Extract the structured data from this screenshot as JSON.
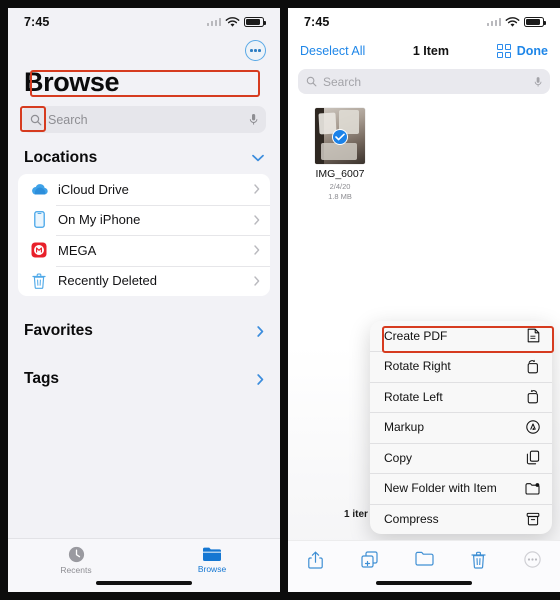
{
  "left": {
    "status": {
      "time": "7:45",
      "wifi_icon": "wifi-icon",
      "battery_icon": "battery-icon"
    },
    "more_button": "more-circle-button",
    "title": "Browse",
    "search": {
      "placeholder": "Search",
      "value": "",
      "icon": "search-icon",
      "mic_icon": "microphone-icon"
    },
    "sections": {
      "locations": {
        "title": "Locations",
        "chevron": "chevron-down-icon",
        "items": [
          {
            "label": "iCloud Drive",
            "icon": "icloud-icon",
            "chevron": "chevron-right-icon"
          },
          {
            "label": "On My iPhone",
            "icon": "iphone-icon",
            "chevron": "chevron-right-icon"
          },
          {
            "label": "MEGA",
            "icon": "mega-icon",
            "chevron": "chevron-right-icon"
          },
          {
            "label": "Recently Deleted",
            "icon": "trash-icon",
            "chevron": "chevron-right-icon"
          }
        ]
      },
      "favorites": {
        "title": "Favorites",
        "chevron": "chevron-right-icon"
      },
      "tags": {
        "title": "Tags",
        "chevron": "chevron-right-icon"
      }
    },
    "tabbar": [
      {
        "label": "Recents",
        "icon": "clock-icon",
        "active": false
      },
      {
        "label": "Browse",
        "icon": "folder-icon",
        "active": true
      }
    ]
  },
  "right": {
    "status": {
      "time": "7:45",
      "wifi_icon": "wifi-icon",
      "battery_icon": "battery-icon"
    },
    "navbar": {
      "deselect_all": "Deselect All",
      "title": "1 Item",
      "grid_icon": "grid-view-icon",
      "done": "Done"
    },
    "search": {
      "placeholder": "Search",
      "value": "",
      "icon": "search-icon",
      "mic_icon": "microphone-icon"
    },
    "file": {
      "name": "IMG_6007",
      "date": "2/4/20",
      "size": "1.8 MB",
      "selected": true,
      "check_icon": "check-circle-icon"
    },
    "selection_count": "1 iter",
    "context_menu": [
      {
        "label": "Create PDF",
        "icon": "pdf-document-icon",
        "highlighted": true
      },
      {
        "label": "Rotate Right",
        "icon": "rotate-right-icon",
        "highlighted": false
      },
      {
        "label": "Rotate Left",
        "icon": "rotate-left-icon",
        "highlighted": false
      },
      {
        "label": "Markup",
        "icon": "markup-icon",
        "highlighted": false
      },
      {
        "label": "Copy",
        "icon": "copy-icon",
        "highlighted": false
      },
      {
        "label": "New Folder with Item",
        "icon": "new-folder-icon",
        "highlighted": false
      },
      {
        "label": "Compress",
        "icon": "compress-icon",
        "highlighted": false
      }
    ],
    "toolbar": [
      {
        "icon": "share-icon"
      },
      {
        "icon": "duplicate-icon"
      },
      {
        "icon": "move-folder-icon"
      },
      {
        "icon": "delete-trash-icon"
      },
      {
        "icon": "more-icon"
      }
    ]
  },
  "colors": {
    "accent_blue": "#1e86e8",
    "highlight_red": "#d63b1f",
    "mega_red": "#e8202a",
    "panel_bg": "#f2f2f6"
  }
}
